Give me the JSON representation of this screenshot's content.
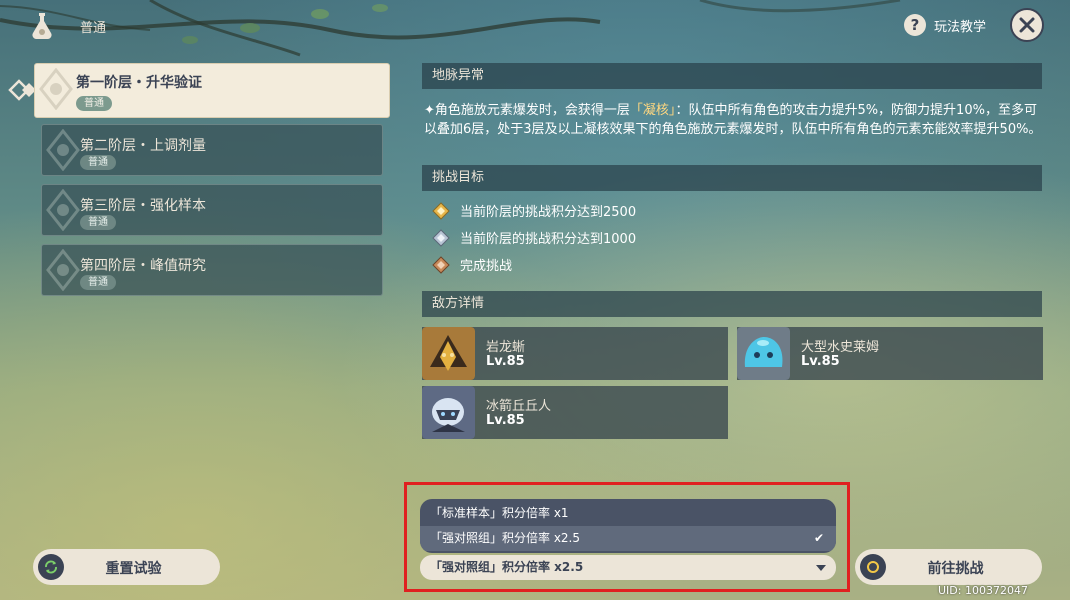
{
  "header": {
    "mode_label": "普通",
    "help_label": "玩法教学",
    "help_icon": "question-icon",
    "close_icon": "close-icon"
  },
  "stages": [
    {
      "title": "第一阶层・升华验证",
      "tag": "普通",
      "active": true
    },
    {
      "title": "第二阶层・上调剂量",
      "tag": "普通",
      "active": false
    },
    {
      "title": "第三阶层・强化样本",
      "tag": "普通",
      "active": false
    },
    {
      "title": "第四阶层・峰值研究",
      "tag": "普通",
      "active": false
    }
  ],
  "ley_line": {
    "heading": "地脉异常",
    "bullet": "✦",
    "text_before": "角色施放元素爆发时，会获得一层",
    "highlight": "「凝核」",
    "text_after": "：队伍中所有角色的攻击力提升5%，防御力提升10%，至多可以叠加6层，处于3层及以上凝核效果下的角色施放元素爆发时，队伍中所有角色的元素充能效率提升50%。"
  },
  "challenge": {
    "heading": "挑战目标",
    "goals": [
      {
        "icon": "gold-medal-icon",
        "text": "当前阶层的挑战积分达到2500"
      },
      {
        "icon": "silver-medal-icon",
        "text": "当前阶层的挑战积分达到1000"
      },
      {
        "icon": "bronze-medal-icon",
        "text": "完成挑战"
      }
    ]
  },
  "enemies": {
    "heading": "敌方详情",
    "list": [
      {
        "name": "岩龙蜥",
        "level": "Lv.85",
        "icon": "geovishap-portrait"
      },
      {
        "name": "大型水史莱姆",
        "level": "Lv.85",
        "icon": "hydro-slime-portrait"
      },
      {
        "name": "冰箭丘丘人",
        "level": "Lv.85",
        "icon": "cryo-hilichurl-portrait"
      }
    ]
  },
  "score_select": {
    "options": [
      "「标准样本」积分倍率 x1",
      "「强对照组」积分倍率 x2.5"
    ],
    "selected": "「强对照组」积分倍率 x2.5"
  },
  "buttons": {
    "reset": "重置试验",
    "go": "前往挑战"
  },
  "uid": "UID: 100372047",
  "colors": {
    "accent_cream": "#ece5d8",
    "dark_text": "#3b4354",
    "highlight_gold": "#ffd780",
    "annotation_red": "#e02020"
  }
}
